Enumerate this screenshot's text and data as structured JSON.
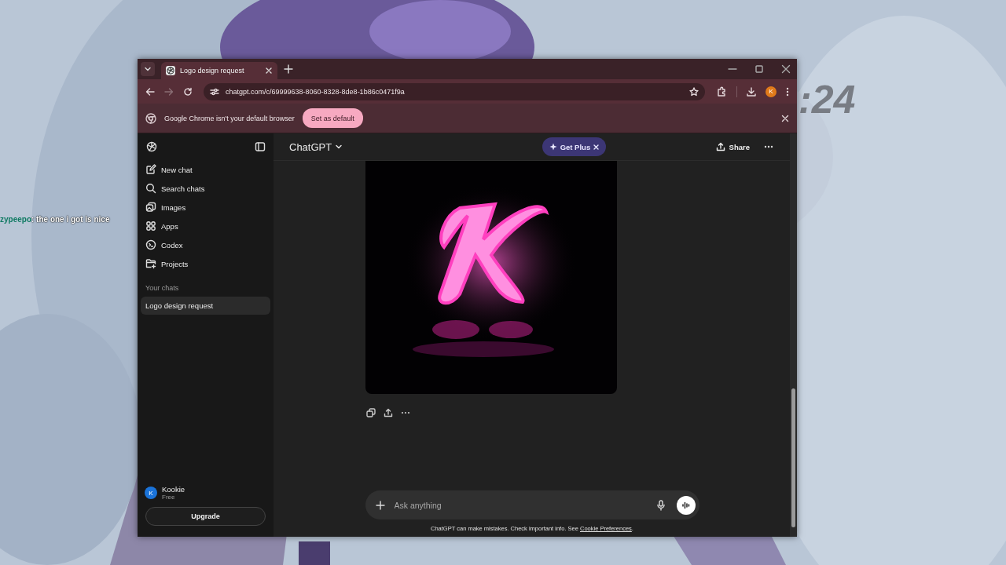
{
  "desktop": {
    "chat": {
      "user": "zypeepo",
      "message": ": the one i got is nice"
    },
    "clock": ":24"
  },
  "browser": {
    "tabs": [
      {
        "title": "Logo design request",
        "selected": true
      }
    ],
    "url": "chatgpt.com/c/69999638-8060-8328-8de8-1b86c0471f9a",
    "profile_initial": "K",
    "infobar": {
      "message": "Google Chrome isn't your default browser",
      "button": "Set as default"
    }
  },
  "sidebar": {
    "items": [
      {
        "label": "New chat"
      },
      {
        "label": "Search chats"
      },
      {
        "label": "Images"
      },
      {
        "label": "Apps"
      },
      {
        "label": "Codex"
      },
      {
        "label": "Projects"
      }
    ],
    "section_title": "Your chats",
    "chats": [
      {
        "title": "Logo design request",
        "selected": true
      }
    ],
    "user": {
      "initial": "K",
      "name": "Kookie",
      "plan": "Free"
    },
    "upgrade_button": "Upgrade"
  },
  "header": {
    "model": "ChatGPT",
    "promo": "Get Plus",
    "share": "Share"
  },
  "composer": {
    "placeholder": "Ask anything"
  },
  "footer": {
    "text": "ChatGPT can make mistakes. Check important info. See ",
    "link": "Cookie Preferences",
    "end": "."
  }
}
